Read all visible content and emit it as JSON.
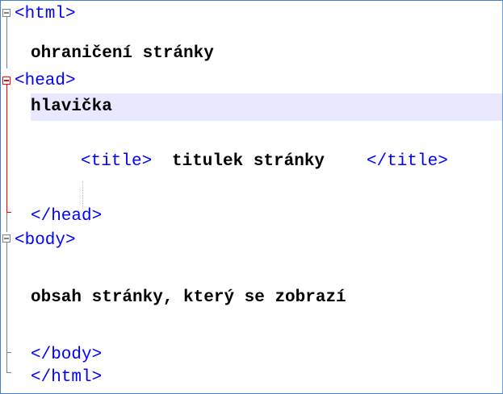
{
  "editor": {
    "lines": [
      {
        "tag": "<html>",
        "text": ""
      },
      {
        "tag": "",
        "text": "ohraničení stránky"
      },
      {
        "tag": "<head>",
        "text": ""
      },
      {
        "tag": "",
        "text": "hlavička"
      },
      {
        "tag": "",
        "text": ""
      },
      {
        "tag_open": "<title>",
        "text": "titulek stránky",
        "tag_close": "</title>"
      },
      {
        "tag": "",
        "text": ""
      },
      {
        "tag": "</head>",
        "text": ""
      },
      {
        "tag": "<body>",
        "text": ""
      },
      {
        "tag": "",
        "text": ""
      },
      {
        "tag": "",
        "text": "obsah stránky, který se zobrazí"
      },
      {
        "tag": "",
        "text": ""
      },
      {
        "tag": "</body>",
        "text": ""
      },
      {
        "tag": "</html>",
        "text": ""
      }
    ],
    "current_line_index": 3,
    "colors": {
      "tag": "#0000ff",
      "text": "#000000",
      "current_line_bg": "#e8e8ff",
      "fold_active": "#ff0000",
      "fold_inactive": "#808080"
    }
  }
}
